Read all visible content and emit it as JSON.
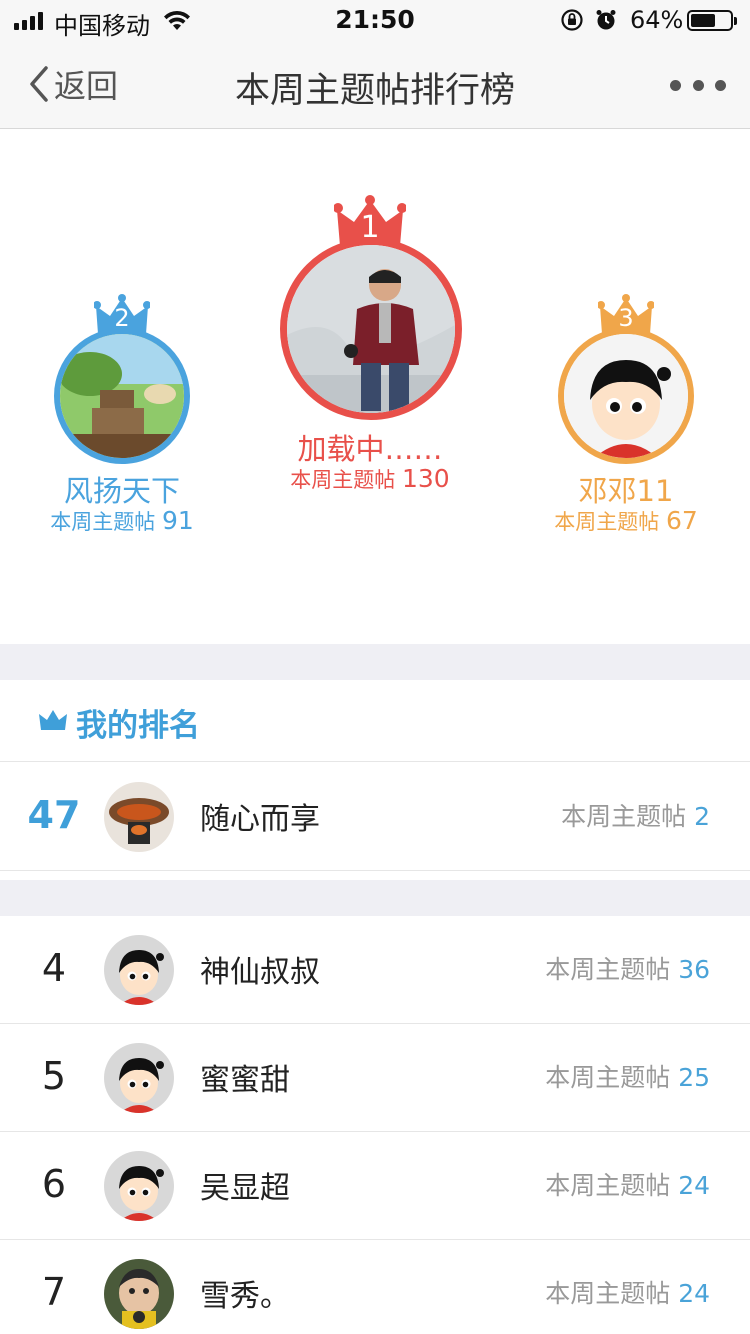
{
  "status_bar": {
    "carrier": "中国移动",
    "time": "21:50",
    "battery_percent_label": "64%",
    "battery_level": 0.64
  },
  "nav": {
    "back_label": "返回",
    "title": "本周主题帖排行榜"
  },
  "podium": [
    {
      "rank": "1",
      "name": "加载中……",
      "count_label": "本周主题帖",
      "count": "130",
      "color": "#e8504a"
    },
    {
      "rank": "2",
      "name": "风扬天下",
      "count_label": "本周主题帖",
      "count": "91",
      "color": "#4aa3de"
    },
    {
      "rank": "3",
      "name": "邓邓11",
      "count_label": "本周主题帖",
      "count": "67",
      "color": "#f0a64a"
    }
  ],
  "my_rank": {
    "title": "我的排名",
    "rank": "47",
    "name": "随心而享",
    "count_label": "本周主题帖",
    "count": "2"
  },
  "list": [
    {
      "rank": "4",
      "name": "神仙叔叔",
      "count_label": "本周主题帖",
      "count": "36"
    },
    {
      "rank": "5",
      "name": "蜜蜜甜",
      "count_label": "本周主题帖",
      "count": "25"
    },
    {
      "rank": "6",
      "name": "吴显超",
      "count_label": "本周主题帖",
      "count": "24"
    },
    {
      "rank": "7",
      "name": "雪秀。",
      "count_label": "本周主题帖",
      "count": "24"
    }
  ],
  "colors": {
    "accent_blue": "#3f9fd9",
    "gold": "#f0a64a",
    "red": "#e8504a"
  }
}
